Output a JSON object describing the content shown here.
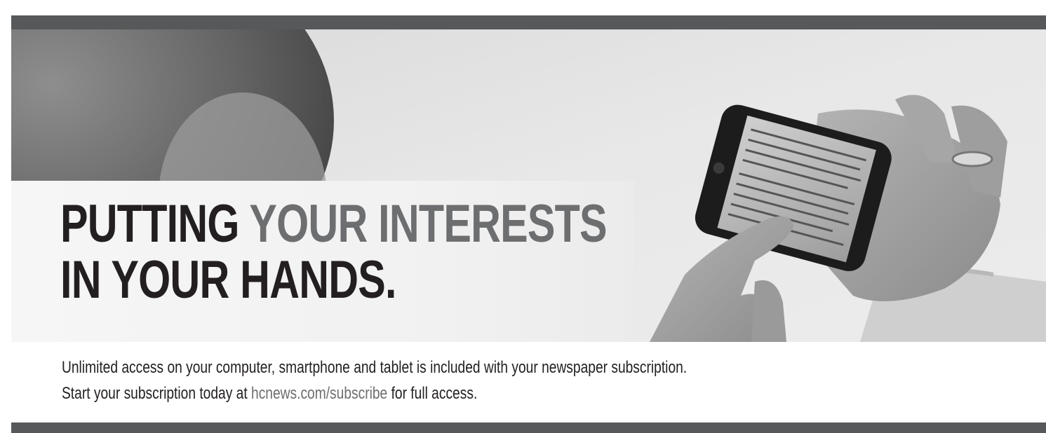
{
  "headline": {
    "line1_dark": "PUTTING",
    "line1_accent": "YOUR INTERESTS",
    "line2": "IN YOUR HANDS."
  },
  "body_copy": {
    "line1": "Unlimited access on your computer, smartphone and tablet is included with your newspaper subscription.",
    "line2_before": "Start your subscription today at",
    "line2_url": "hcnews.com/subscribe",
    "line2_after": "for full access."
  },
  "colors": {
    "bar": "#57585a",
    "headline_dark": "#231f20",
    "headline_accent": "#6d6e70",
    "panel": "#f2f2f2"
  },
  "photo": {
    "subject": "hands holding smartphone"
  }
}
